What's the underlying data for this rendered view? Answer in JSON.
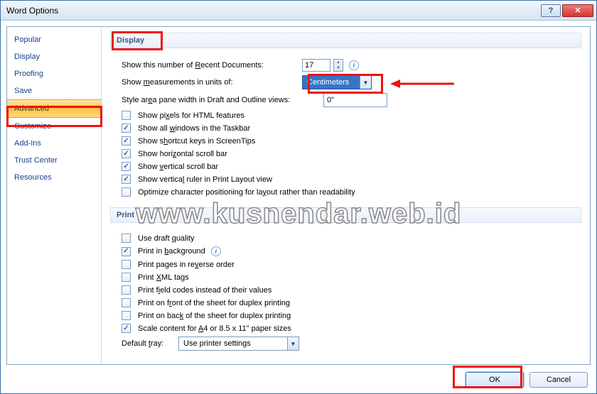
{
  "window": {
    "title": "Word Options"
  },
  "sidebar": {
    "items": [
      {
        "label": "Popular"
      },
      {
        "label": "Display"
      },
      {
        "label": "Proofing"
      },
      {
        "label": "Save"
      },
      {
        "label": "Advanced",
        "selected": true
      },
      {
        "label": "Customize"
      },
      {
        "label": "Add-Ins"
      },
      {
        "label": "Trust Center"
      },
      {
        "label": "Resources"
      }
    ]
  },
  "sections": {
    "display": {
      "title": "Display",
      "recent_label_pre": "Show this number of ",
      "recent_label_u": "R",
      "recent_label_post": "ecent Documents:",
      "recent_value": "17",
      "units_label_pre": "Show ",
      "units_label_u": "m",
      "units_label_post": "easurements in units of:",
      "units_value": "Centimeters",
      "style_label_pre": "Style ar",
      "style_label_u": "e",
      "style_label_post": "a pane width in Draft and Outline views:",
      "style_value": "0\"",
      "checks": [
        {
          "checked": false,
          "pre": "Show pi",
          "u": "x",
          "post": "els for HTML features"
        },
        {
          "checked": true,
          "pre": "Show all ",
          "u": "w",
          "post": "indows in the Taskbar"
        },
        {
          "checked": true,
          "pre": "Show s",
          "u": "h",
          "post": "ortcut keys in ScreenTips"
        },
        {
          "checked": true,
          "pre": "Show hori",
          "u": "z",
          "post": "ontal scroll bar"
        },
        {
          "checked": true,
          "pre": "Show ",
          "u": "v",
          "post": "ertical scroll bar"
        },
        {
          "checked": true,
          "pre": "Show vertica",
          "u": "l",
          "post": " ruler in Print Layout view"
        },
        {
          "checked": false,
          "pre": "Optimize character positioning for la",
          "u": "y",
          "post": "out rather than readability"
        }
      ]
    },
    "print": {
      "title": "Print",
      "checks": [
        {
          "checked": false,
          "pre": "Use draft ",
          "u": "q",
          "post": "uality"
        },
        {
          "checked": true,
          "pre": "Print in ",
          "u": "b",
          "post": "ackground",
          "info": true
        },
        {
          "checked": false,
          "pre": "Print pages in re",
          "u": "v",
          "post": "erse order"
        },
        {
          "checked": false,
          "pre": "Print ",
          "u": "X",
          "post": "ML tags"
        },
        {
          "checked": false,
          "pre": "Print f",
          "u": "i",
          "post": "eld codes instead of their values"
        },
        {
          "checked": false,
          "pre": "Print on f",
          "u": "r",
          "post": "ont of the sheet for duplex printing"
        },
        {
          "checked": false,
          "pre": "Print on bac",
          "u": "k",
          "post": " of the sheet for duplex printing"
        },
        {
          "checked": true,
          "pre": "Scale content for ",
          "u": "A",
          "post": "4 or 8.5 x 11\" paper sizes"
        }
      ],
      "tray_label_pre": "Default ",
      "tray_label_u": "t",
      "tray_label_post": "ray:",
      "tray_value": "Use printer settings"
    }
  },
  "buttons": {
    "ok": "OK",
    "cancel": "Cancel"
  },
  "watermark": "www.kusnendar.web.id"
}
